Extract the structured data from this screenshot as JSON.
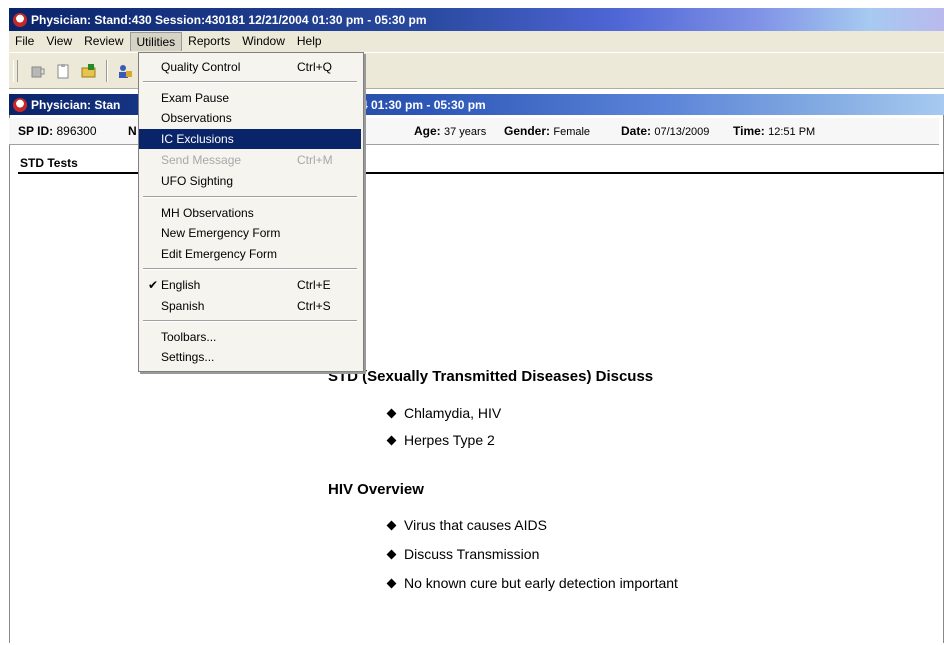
{
  "window": {
    "title": "Physician: Stand:430 Session:430181 12/21/2004 01:30 pm - 05:30 pm"
  },
  "menubar": {
    "items": [
      "File",
      "View",
      "Review",
      "Utilities",
      "Reports",
      "Window",
      "Help"
    ]
  },
  "utilities_menu": {
    "items": [
      {
        "label": "Quality Control",
        "shortcut": "Ctrl+Q"
      },
      {
        "label": "Exam Pause",
        "shortcut": ""
      },
      {
        "label": "Observations",
        "shortcut": ""
      },
      {
        "label": "IC Exclusions",
        "shortcut": "",
        "highlighted": true
      },
      {
        "label": "Send Message",
        "shortcut": "Ctrl+M",
        "disabled": true
      },
      {
        "label": "UFO Sighting",
        "shortcut": ""
      },
      {
        "label": "MH Observations",
        "shortcut": ""
      },
      {
        "label": "New Emergency Form",
        "shortcut": ""
      },
      {
        "label": "Edit Emergency Form",
        "shortcut": ""
      },
      {
        "label": "English",
        "shortcut": "Ctrl+E",
        "checked": true
      },
      {
        "label": "Spanish",
        "shortcut": "Ctrl+S"
      },
      {
        "label": "Toolbars...",
        "shortcut": ""
      },
      {
        "label": "Settings...",
        "shortcut": ""
      }
    ]
  },
  "inner_window": {
    "title_left": "Physician: Stan",
    "title_right": "4 01:30 pm - 05:30 pm"
  },
  "info": {
    "sp_label": "SP ID:",
    "sp_value": "896300",
    "n_label": "N",
    "age_label": "Age:",
    "age_value": "37 years",
    "gender_label": "Gender:",
    "gender_value": "Female",
    "date_label": "Date:",
    "date_value": "07/13/2009",
    "time_label": "Time:",
    "time_value": "12:51 PM"
  },
  "section": {
    "title": "STD Tests"
  },
  "content": {
    "std_heading": "STD (Sexually Transmitted Diseases) Discuss",
    "std_items": [
      "Chlamydia, HIV",
      "Herpes Type 2"
    ],
    "hiv_heading": "HIV Overview",
    "hiv_items": [
      "Virus that causes AIDS",
      "Discuss Transmission",
      "No known cure but early detection important"
    ]
  },
  "colors": {
    "title_bar": "#0a246a",
    "menu_highlight": "#0a246a",
    "chrome": "#ece9d8"
  }
}
